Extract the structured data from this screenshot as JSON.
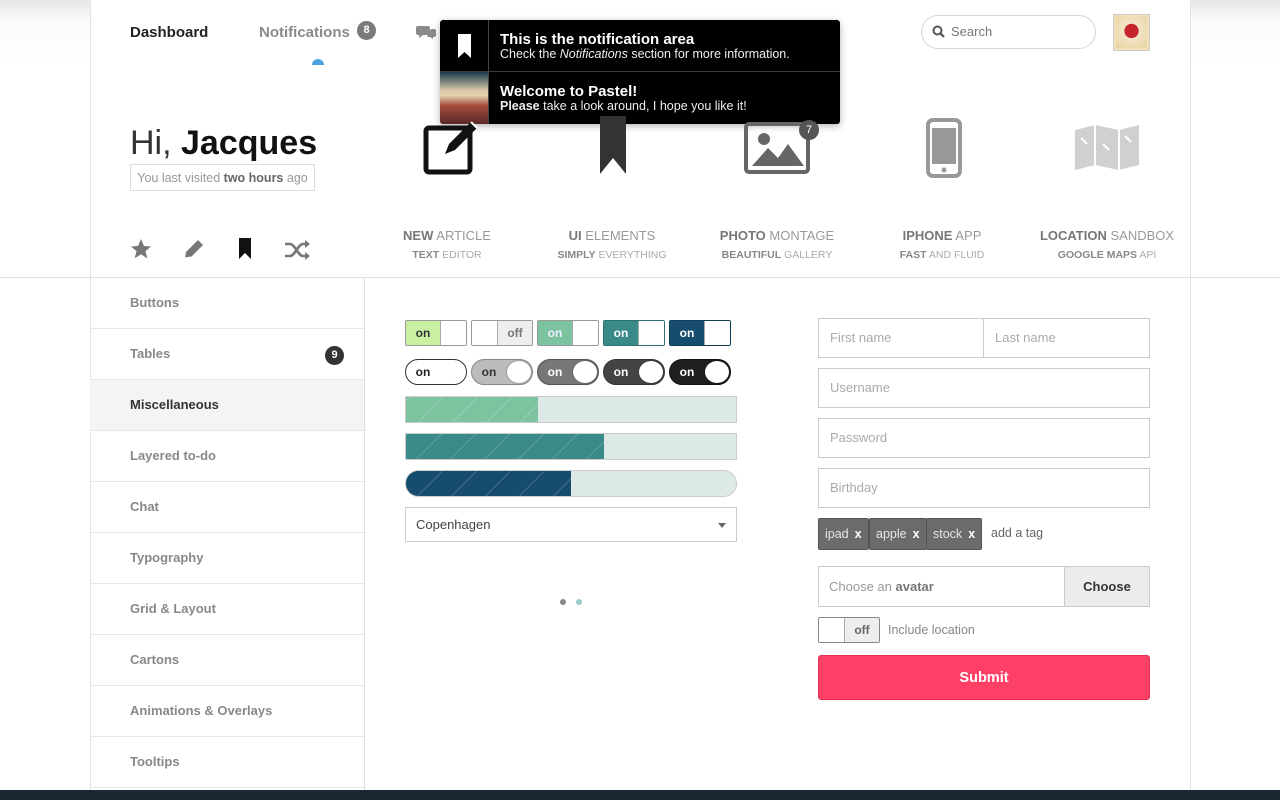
{
  "nav": {
    "dashboard": "Dashboard",
    "notifications": "Notifications",
    "notifications_count": "8",
    "search_placeholder": "Search"
  },
  "popup": {
    "item1_title": "This is the notification area",
    "item1_text_pre": "Check the ",
    "item1_text_em": "Notifications",
    "item1_text_post": " section for more information.",
    "item2_title": "Welcome to Pastel!",
    "item2_text_bold": "Please",
    "item2_text_rest": " take a look around, I hope you like it!"
  },
  "greeting": {
    "hi": "Hi,",
    "name": "Jacques",
    "visited_pre": "You last visited",
    "visited_bold": "two hours",
    "visited_post": "ago"
  },
  "photo_badge": "7",
  "features": [
    {
      "title_bold": "NEW",
      "title": "ARTICLE",
      "sub_bold": "TEXT",
      "sub": "EDITOR"
    },
    {
      "title_bold": "UI",
      "title": "ELEMENTS",
      "sub_bold": "SIMPLY",
      "sub": "EVERYTHING"
    },
    {
      "title_bold": "PHOTO",
      "title": "MONTAGE",
      "sub_bold": "BEAUTIFUL",
      "sub": "GALLERY"
    },
    {
      "title_bold": "IPHONE",
      "title": "APP",
      "sub_bold": "FAST",
      "sub": "AND FLUID"
    },
    {
      "title_bold": "LOCATION",
      "title": "SANDBOX",
      "sub_bold": "GOOGLE MAPS",
      "sub": "API"
    }
  ],
  "sidebar": {
    "items": [
      {
        "label": "Buttons"
      },
      {
        "label": "Tables",
        "badge": "9"
      },
      {
        "label": "Miscellaneous"
      },
      {
        "label": "Layered to-do"
      },
      {
        "label": "Chat"
      },
      {
        "label": "Typography"
      },
      {
        "label": "Grid & Layout"
      },
      {
        "label": "Cartons"
      },
      {
        "label": "Animations & Overlays"
      },
      {
        "label": "Tooltips"
      }
    ]
  },
  "toggles": {
    "on": "on",
    "off": "off"
  },
  "progress": [
    {
      "value": 0.4,
      "color": "#7cc4a0"
    },
    {
      "value": 0.6,
      "color": "#3a8a8a"
    },
    {
      "value": 0.5,
      "color": "#164d6e"
    }
  ],
  "select_value": "Copenhagen",
  "form": {
    "first_name": "First name",
    "last_name": "Last name",
    "username": "Username",
    "password": "Password",
    "birthday": "Birthday",
    "tags": [
      "ipad",
      "apple",
      "stock"
    ],
    "tag_remove": "x",
    "add_tag": "add a tag",
    "avatar_pre": "Choose an",
    "avatar_bold": "avatar",
    "choose": "Choose",
    "location_toggle": "off",
    "include_location": "Include location",
    "submit": "Submit"
  },
  "colors": {
    "accent": "#ff4066",
    "toggle_lime": "#c9f0a2",
    "toggle_mint": "#7cc4a0",
    "toggle_teal": "#3a8a8a",
    "toggle_navy": "#164d6e"
  }
}
